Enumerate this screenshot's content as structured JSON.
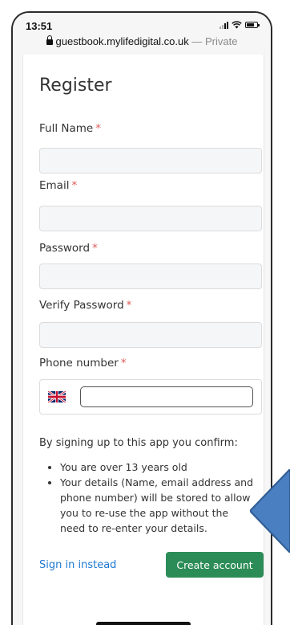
{
  "status_bar": {
    "time": "13:51"
  },
  "browser": {
    "domain": "guestbook.mylifedigital.co.uk",
    "suffix": " — Private"
  },
  "form": {
    "title": "Register",
    "required_marker": "*",
    "fields": [
      {
        "label": "Full Name",
        "value": "",
        "placeholder": ""
      },
      {
        "label": "Email",
        "value": "",
        "placeholder": ""
      },
      {
        "label": "Password",
        "value": "",
        "placeholder": ""
      },
      {
        "label": "Verify Password",
        "value": "",
        "placeholder": ""
      }
    ],
    "phone": {
      "label": "Phone number",
      "value": "",
      "placeholder": ""
    }
  },
  "confirmation": {
    "intro": "By signing up to this app you confirm:",
    "items": [
      "You are over 13 years old",
      "Your details (Name, email address and phone number) will be stored to allow you to re-use the app without the need to re-enter your details."
    ]
  },
  "actions": {
    "signin_label": "Sign in instead",
    "create_label": "Create account"
  },
  "colors": {
    "accent_link": "#1f78d1",
    "primary_button": "#2c8c57",
    "required_marker": "#e05a5a",
    "annotation_arrow": "#4a7fc1"
  },
  "icons": {
    "lock": "lock-icon",
    "flag": "uk-flag-icon",
    "signal": "signal-icon",
    "wifi": "wifi-icon",
    "battery": "battery-icon"
  }
}
